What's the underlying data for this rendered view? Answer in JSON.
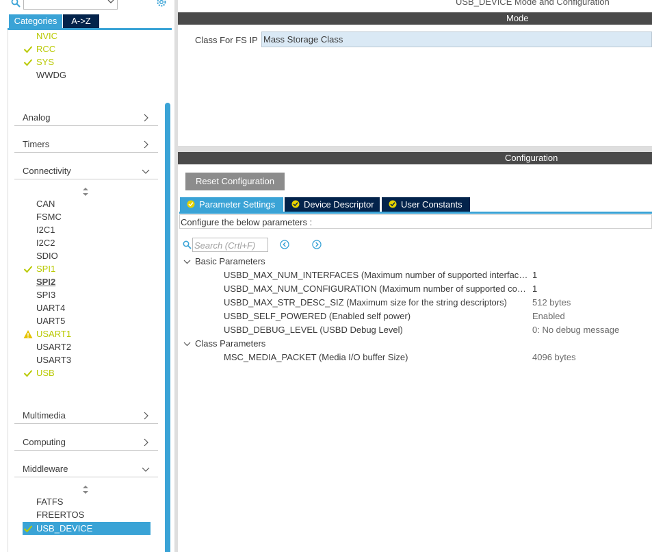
{
  "left": {
    "tabs": {
      "categories": "Categories",
      "az": "A->Z"
    },
    "top_items": [
      {
        "label": "NVIC",
        "status": "none",
        "color": "green"
      },
      {
        "label": "RCC",
        "status": "check"
      },
      {
        "label": "SYS",
        "status": "check"
      },
      {
        "label": "WWDG",
        "status": "none"
      }
    ],
    "categories": {
      "analog": "Analog",
      "timers": "Timers",
      "connectivity": "Connectivity",
      "multimedia": "Multimedia",
      "computing": "Computing",
      "middleware": "Middleware"
    },
    "connectivity_items": [
      {
        "label": "CAN",
        "status": "none"
      },
      {
        "label": "FSMC",
        "status": "none"
      },
      {
        "label": "I2C1",
        "status": "none"
      },
      {
        "label": "I2C2",
        "status": "none"
      },
      {
        "label": "SDIO",
        "status": "none"
      },
      {
        "label": "SPI1",
        "status": "check"
      },
      {
        "label": "SPI2",
        "status": "bold"
      },
      {
        "label": "SPI3",
        "status": "none"
      },
      {
        "label": "UART4",
        "status": "none"
      },
      {
        "label": "UART5",
        "status": "none"
      },
      {
        "label": "USART1",
        "status": "warning"
      },
      {
        "label": "USART2",
        "status": "none"
      },
      {
        "label": "USART3",
        "status": "none"
      },
      {
        "label": "USB",
        "status": "check"
      }
    ],
    "middleware_items": [
      {
        "label": "FATFS",
        "status": "none"
      },
      {
        "label": "FREERTOS",
        "status": "none"
      },
      {
        "label": "USB_DEVICE",
        "status": "selected"
      }
    ],
    "colors": {
      "accent": "#3aa3d6",
      "dark_tab": "#03234b",
      "ok_green": "#b9c900",
      "warn_yellow": "#e6c300"
    }
  },
  "right": {
    "title": "USB_DEVICE Mode and Configuration",
    "mode_bar": "Mode",
    "class_label": "Class For FS IP",
    "class_value": "Mass Storage Class",
    "config_bar": "Configuration",
    "reset_button": "Reset Configuration",
    "tabs": {
      "param": "Parameter Settings",
      "device": "Device Descriptor",
      "user": "User Constants"
    },
    "configure_text": "Configure the below parameters :",
    "search_placeholder": "Search (Crtl+F)",
    "groups": [
      {
        "label": "Basic Parameters",
        "rows": [
          {
            "name": "USBD_MAX_NUM_INTERFACES (Maximum number of supported interfaces)",
            "value": "1"
          },
          {
            "name": "USBD_MAX_NUM_CONFIGURATION (Maximum number of supported confi...",
            "value": "1"
          },
          {
            "name": "USBD_MAX_STR_DESC_SIZ (Maximum size for the string descriptors)",
            "value": "512 bytes"
          },
          {
            "name": "USBD_SELF_POWERED (Enabled self power)",
            "value": "Enabled"
          },
          {
            "name": "USBD_DEBUG_LEVEL (USBD Debug Level)",
            "value": "0: No debug message"
          }
        ]
      },
      {
        "label": "Class Parameters",
        "rows": [
          {
            "name": "MSC_MEDIA_PACKET (Media I/O buffer Size)",
            "value": "4096 bytes"
          }
        ]
      }
    ]
  }
}
